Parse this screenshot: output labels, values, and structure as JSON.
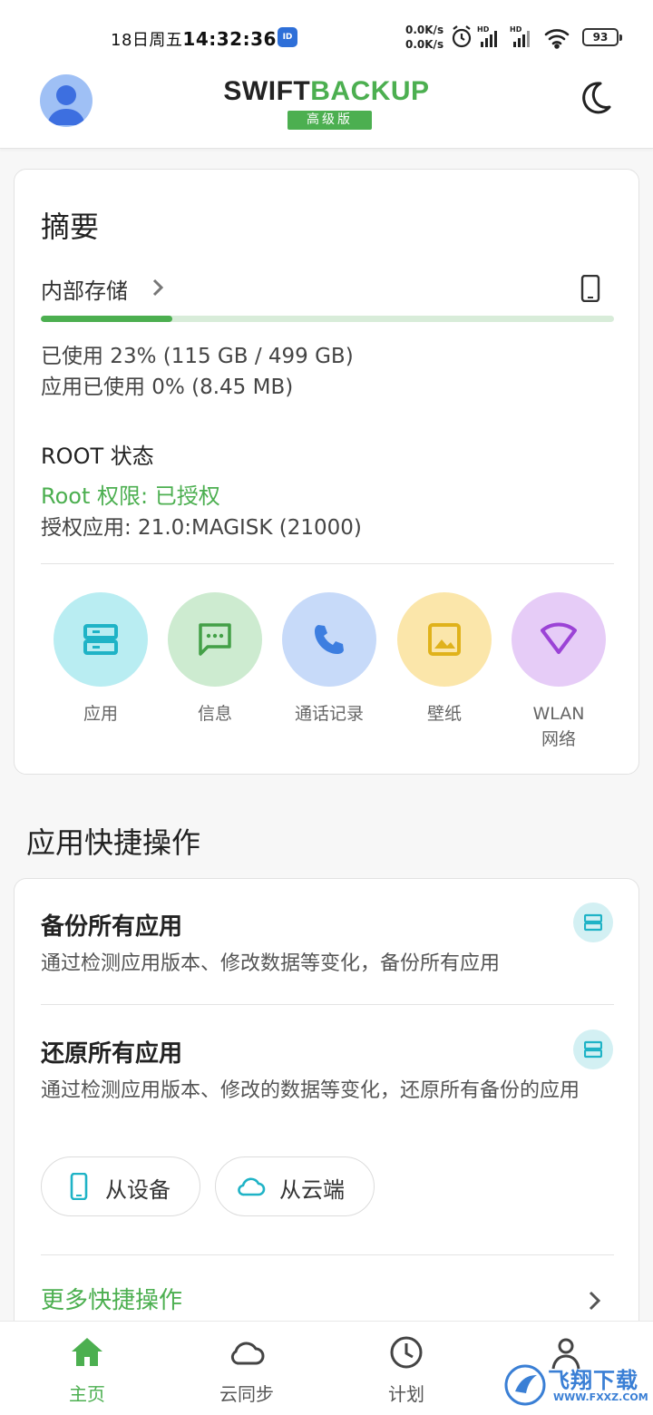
{
  "status_bar": {
    "date": "18日周五",
    "time": "14:32:36",
    "net_up": "0.0K/s",
    "net_down": "0.0K/s",
    "battery": "93"
  },
  "app_bar": {
    "logo_part1": "SWIFT",
    "logo_part2": "BACKUP",
    "edition_badge": "高级版",
    "brand_color": "#4caf50"
  },
  "summary": {
    "title": "摘要",
    "storage_label": "内部存储",
    "storage_used_fraction": 0.23,
    "used_text": "已使用 23% (115 GB / 499 GB)",
    "app_used_text": "应用已使用 0% (8.45 MB)",
    "root_title": "ROOT 状态",
    "root_permission": "Root 权限: 已授权",
    "root_app": "授权应用: 21.0:MAGISK (21000)",
    "categories": [
      {
        "label": "应用",
        "icon": "apps-icon",
        "bg": "#b9edf2",
        "fg": "#1fb3c6"
      },
      {
        "label": "信息",
        "icon": "message-icon",
        "bg": "#cdebd0",
        "fg": "#43a047"
      },
      {
        "label": "通话记录",
        "icon": "phone-icon",
        "bg": "#c7daf9",
        "fg": "#3d7ee0"
      },
      {
        "label": "壁纸",
        "icon": "image-icon",
        "bg": "#fbe6aa",
        "fg": "#e0b21b"
      },
      {
        "label": "WLAN\n网络",
        "label_line1": "WLAN",
        "label_line2": "网络",
        "icon": "wifi-icon",
        "bg": "#e6ccf7",
        "fg": "#9b43d6"
      }
    ]
  },
  "quick_actions": {
    "section_title": "应用快捷操作",
    "backup_title": "备份所有应用",
    "backup_desc": "通过检测应用版本、修改数据等变化，备份所有应用",
    "restore_title": "还原所有应用",
    "restore_desc": "通过检测应用版本、修改的数据等变化，还原所有备份的应用",
    "from_device": "从设备",
    "from_cloud": "从云端",
    "more": "更多快捷操作"
  },
  "bottom_nav": {
    "items": [
      {
        "label": "主页",
        "icon": "home-icon",
        "active": true
      },
      {
        "label": "云同步",
        "icon": "cloud-icon",
        "active": false
      },
      {
        "label": "计划",
        "icon": "clock-icon",
        "active": false
      },
      {
        "label": "",
        "icon": "person-icon",
        "active": false
      }
    ]
  },
  "watermark": {
    "text": "飞翔下载",
    "sub": "WWW.FXXZ.COM"
  }
}
